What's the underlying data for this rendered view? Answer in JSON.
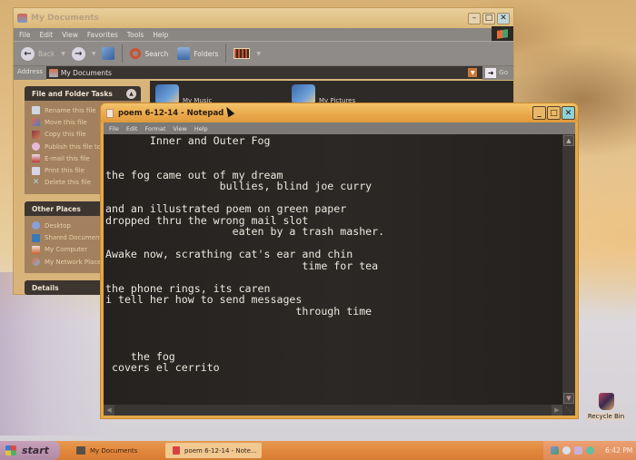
{
  "explorer": {
    "title": "My Documents",
    "menu": [
      "File",
      "Edit",
      "View",
      "Favorites",
      "Tools",
      "Help"
    ],
    "toolbar": {
      "back_label": "Back",
      "search_label": "Search",
      "folders_label": "Folders"
    },
    "address": {
      "label": "Address",
      "value": "My Documents",
      "go_label": "Go"
    },
    "tasks_panel": {
      "title": "File and Folder Tasks",
      "items": [
        {
          "label": "Rename this file",
          "icon": "rename-icon"
        },
        {
          "label": "Move this file",
          "icon": "move-icon"
        },
        {
          "label": "Copy this file",
          "icon": "copy-icon"
        },
        {
          "label": "Publish this file to the Web",
          "icon": "publish-icon"
        },
        {
          "label": "E-mail this file",
          "icon": "email-icon"
        },
        {
          "label": "Print this file",
          "icon": "print-icon"
        },
        {
          "label": "Delete this file",
          "icon": "delete-icon"
        }
      ]
    },
    "places_panel": {
      "title": "Other Places",
      "items": [
        {
          "label": "Desktop",
          "icon": "desktop-icon"
        },
        {
          "label": "Shared Documents",
          "icon": "shared-folder-icon"
        },
        {
          "label": "My Computer",
          "icon": "computer-icon"
        },
        {
          "label": "My Network Places",
          "icon": "network-icon"
        }
      ]
    },
    "details_panel": {
      "title": "Details"
    },
    "folders": [
      {
        "label": "My Music"
      },
      {
        "label": "My Pictures"
      }
    ]
  },
  "notepad": {
    "title": "poem 6-12-14 - Notepad",
    "menu": [
      "File",
      "Edit",
      "Format",
      "View",
      "Help"
    ],
    "content": "       Inner and Outer Fog\n\n\nthe fog came out of my dream\n                  bullies, blind joe curry\n\nand an illustrated poem on green paper\ndropped thru the wrong mail slot\n                    eaten by a trash masher.\n\nAwake now, scrathing cat's ear and chin\n                               time for tea\n\nthe phone rings, its caren\ni tell her how to send messages\n                              through time\n\n\n\n    the fog\n covers el cerrito"
  },
  "desktop": {
    "recycle_bin_label": "Recycle Bin"
  },
  "taskbar": {
    "start_label": "start",
    "tasks": [
      {
        "label": "My Documents"
      },
      {
        "label": "poem 6-12-14 - Note..."
      }
    ],
    "clock": "6:42 PM"
  }
}
